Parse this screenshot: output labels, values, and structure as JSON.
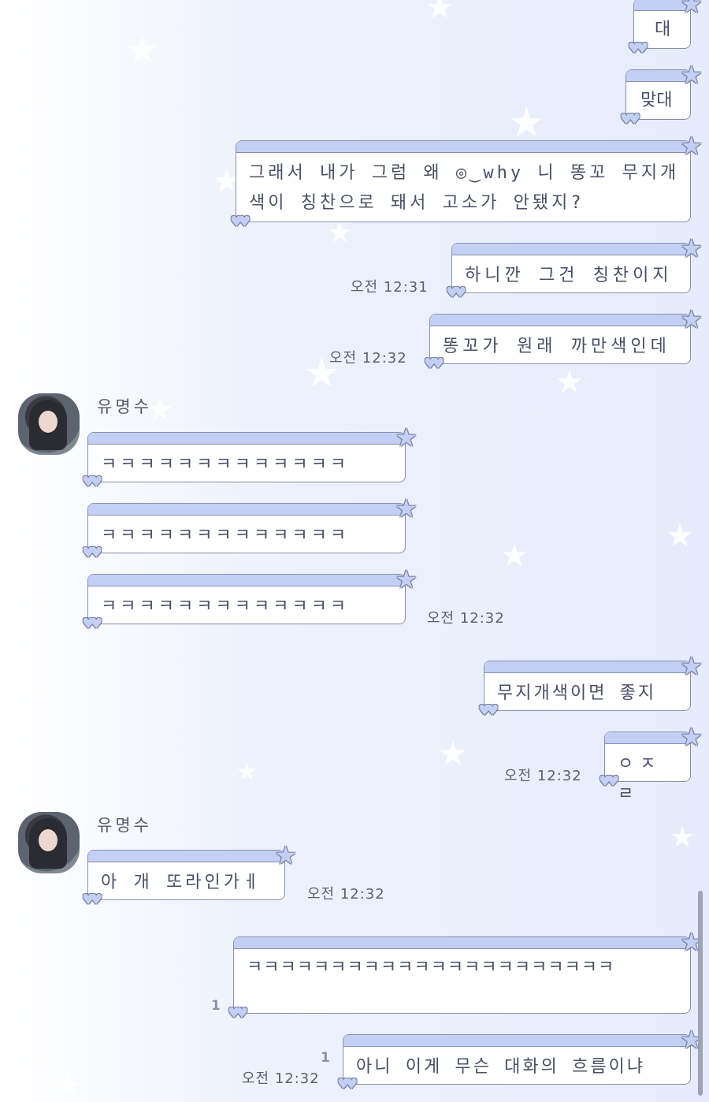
{
  "colors": {
    "bubble_bar": "#c3cff5",
    "bubble_border": "#8a8fa8",
    "text": "#4a4f66",
    "background": "#e6ecfb"
  },
  "messages": [
    {
      "id": "m1",
      "side": "right",
      "text": "대"
    },
    {
      "id": "m2",
      "side": "right",
      "text": "맞대"
    },
    {
      "id": "m3",
      "side": "right",
      "text": "그래서 내가 그럼 왜 ◎‿why 니 똥꼬 무지개색이 칭찬으로 돼서 고소가 안됐지?"
    },
    {
      "id": "m4",
      "side": "right",
      "text": "하니깐 그건 칭찬이지",
      "time": "오전 12:31"
    },
    {
      "id": "m5",
      "side": "right",
      "text": "똥꼬가 원래 까만색인데",
      "time": "오전 12:32"
    },
    {
      "id": "m6",
      "side": "left",
      "sender": "유명수",
      "text": "ㅋㅋㅋㅋㅋㅋㅋㅋㅋㅋㅋㅋㅋ"
    },
    {
      "id": "m7",
      "side": "left",
      "text": "ㅋㅋㅋㅋㅋㅋㅋㅋㅋㅋㅋㅋㅋ"
    },
    {
      "id": "m8",
      "side": "left",
      "text": "ㅋㅋㅋㅋㅋㅋㅋㅋㅋㅋㅋㅋㅋ",
      "time": "오전 12:32"
    },
    {
      "id": "m9",
      "side": "right",
      "text": "무지개색이면 좋지"
    },
    {
      "id": "m10",
      "side": "right",
      "text": "ㅇㅈㄹ",
      "time": "오전 12:32"
    },
    {
      "id": "m11",
      "side": "left",
      "sender": "유명수",
      "text": "아 개 또라인가ㅔ",
      "time": "오전 12:32"
    },
    {
      "id": "m12",
      "side": "right",
      "text": "ㅋㅋㅋㅋㅋㅋㅋㅋㅋㅋㅋㅋㅋㅋㅋㅋㅋㅋㅋㅋㅋㅋ",
      "unread": "1"
    },
    {
      "id": "m13",
      "side": "right",
      "text": "아니 이게 무슨 대화의 흐름이냐",
      "time": "오전 12:32",
      "unread": "1"
    }
  ],
  "sender_name": "유명수"
}
